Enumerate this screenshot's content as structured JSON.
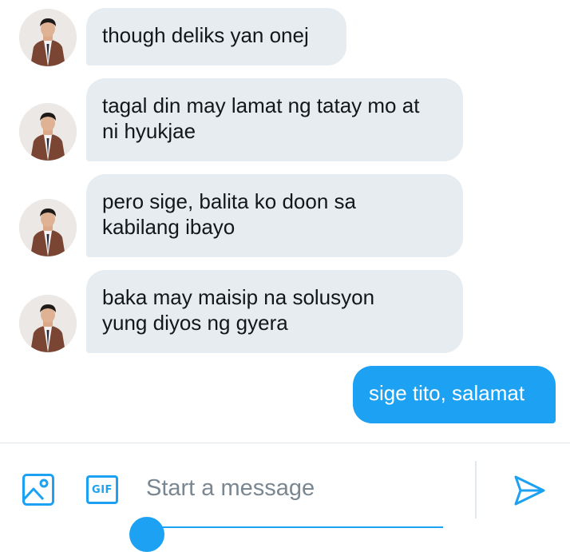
{
  "messages": [
    {
      "direction": "incoming",
      "text": "though deliks yan onej",
      "avatar": "user-avatar-photo"
    },
    {
      "direction": "incoming",
      "text": "tagal din may lamat ng tatay mo at\nni hyukjae",
      "avatar": "user-avatar-photo"
    },
    {
      "direction": "incoming",
      "text": "pero sige, balita ko doon sa\nkabilang ibayo",
      "avatar": "user-avatar-photo"
    },
    {
      "direction": "incoming",
      "text": "baka may maisip na solusyon\nyung diyos ng gyera",
      "avatar": "user-avatar-photo"
    },
    {
      "direction": "outgoing",
      "text": "sige tito, salamat"
    }
  ],
  "composer": {
    "placeholder": "Start a message",
    "value": "",
    "gif_label": "GIF",
    "icons": {
      "media": "image-icon",
      "gif": "gif-icon",
      "send": "send-icon"
    }
  },
  "colors": {
    "accent": "#1da1f2",
    "incoming_bubble": "#e6ecf0",
    "text": "#14171a",
    "placeholder": "#7a8791",
    "divider": "#e1e8ed"
  }
}
